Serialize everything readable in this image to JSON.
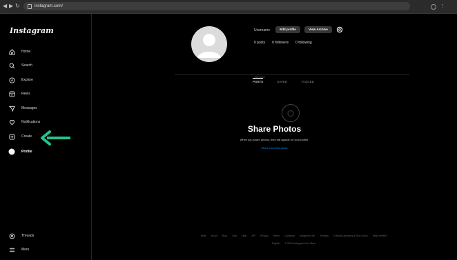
{
  "browser": {
    "back": "◀",
    "forward": "▶",
    "reload": "↻",
    "url": "instagram.com/"
  },
  "sidebar": {
    "logo": "Instagram",
    "items": [
      {
        "label": "Home",
        "icon": "home-icon"
      },
      {
        "label": "Search",
        "icon": "search-icon"
      },
      {
        "label": "Explore",
        "icon": "compass-icon"
      },
      {
        "label": "Reels",
        "icon": "reels-icon"
      },
      {
        "label": "Messages",
        "icon": "messenger-icon"
      },
      {
        "label": "Notifications",
        "icon": "heart-icon"
      },
      {
        "label": "Create",
        "icon": "plus-square-icon"
      },
      {
        "label": "Profile",
        "icon": "avatar-icon"
      }
    ],
    "bottom": [
      {
        "label": "Threads",
        "icon": "threads-icon"
      },
      {
        "label": "More",
        "icon": "menu-icon"
      }
    ]
  },
  "arrow_color": "#22c58a",
  "profile": {
    "username": "Username",
    "edit_button": "Edit profile",
    "archive_button": "View Archive",
    "stats": [
      "0 posts",
      "0 followers",
      "0 following"
    ],
    "tabs_caption": "Username",
    "tabs": [
      "POSTS",
      "SAVED",
      "TAGGED"
    ]
  },
  "empty_state": {
    "title": "Share Photos",
    "subtitle": "When you share photos, they will appear on your profile.",
    "link": "Share your first photo"
  },
  "footer": {
    "links": [
      "Meta",
      "About",
      "Blog",
      "Jobs",
      "Help",
      "API",
      "Privacy",
      "Terms",
      "Locations",
      "Instagram Lite",
      "Threads",
      "Contact Uploading & Non-Users",
      "Meta Verified"
    ],
    "language": "English",
    "copyright": "© 2024 Instagram from Meta"
  }
}
